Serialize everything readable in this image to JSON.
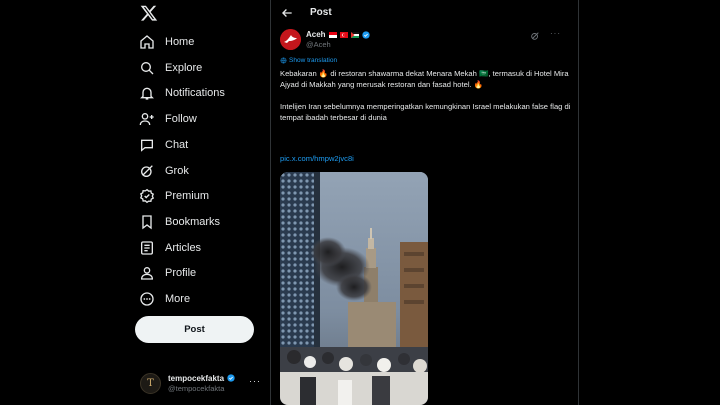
{
  "sidebar": {
    "logo_icon": "x-logo-icon",
    "items": [
      {
        "label": "Home",
        "icon": "home-icon"
      },
      {
        "label": "Explore",
        "icon": "search-icon"
      },
      {
        "label": "Notifications",
        "icon": "bell-icon"
      },
      {
        "label": "Follow",
        "icon": "follow-icon"
      },
      {
        "label": "Chat",
        "icon": "chat-icon"
      },
      {
        "label": "Grok",
        "icon": "grok-icon"
      },
      {
        "label": "Premium",
        "icon": "premium-icon"
      },
      {
        "label": "Bookmarks",
        "icon": "bookmark-icon"
      },
      {
        "label": "Articles",
        "icon": "articles-icon"
      },
      {
        "label": "Profile",
        "icon": "profile-icon"
      },
      {
        "label": "More",
        "icon": "more-circle-icon"
      }
    ],
    "post_label": "Post",
    "account": {
      "avatar_letter": "T",
      "name": "tempocekfakta",
      "handle": "@tempocekfakta",
      "more": "···"
    }
  },
  "main": {
    "title": "Post",
    "author": {
      "name": "Aceh",
      "handle": "@Aceh",
      "more": "···"
    },
    "translate_label": "Show translation",
    "paragraph1": "Kebakaran 🔥 di restoran shawarma dekat Menara Mekah 🇸🇦, termasuk di Hotel Mira Ajyad di Makkah yang merusak restoran dan fasad hotel. 🔥",
    "paragraph2": "Intelijen Iran sebelumnya memperingatkan kemungkinan Israel melakukan false flag di tempat ibadah terbesar di dunia",
    "link": "pic.x.com/hmpw2jvc8i"
  },
  "colors": {
    "background": "#000000",
    "text": "#e7e9ea",
    "muted": "#71767b",
    "accent": "#1d9bf0",
    "border": "#2f3336"
  }
}
